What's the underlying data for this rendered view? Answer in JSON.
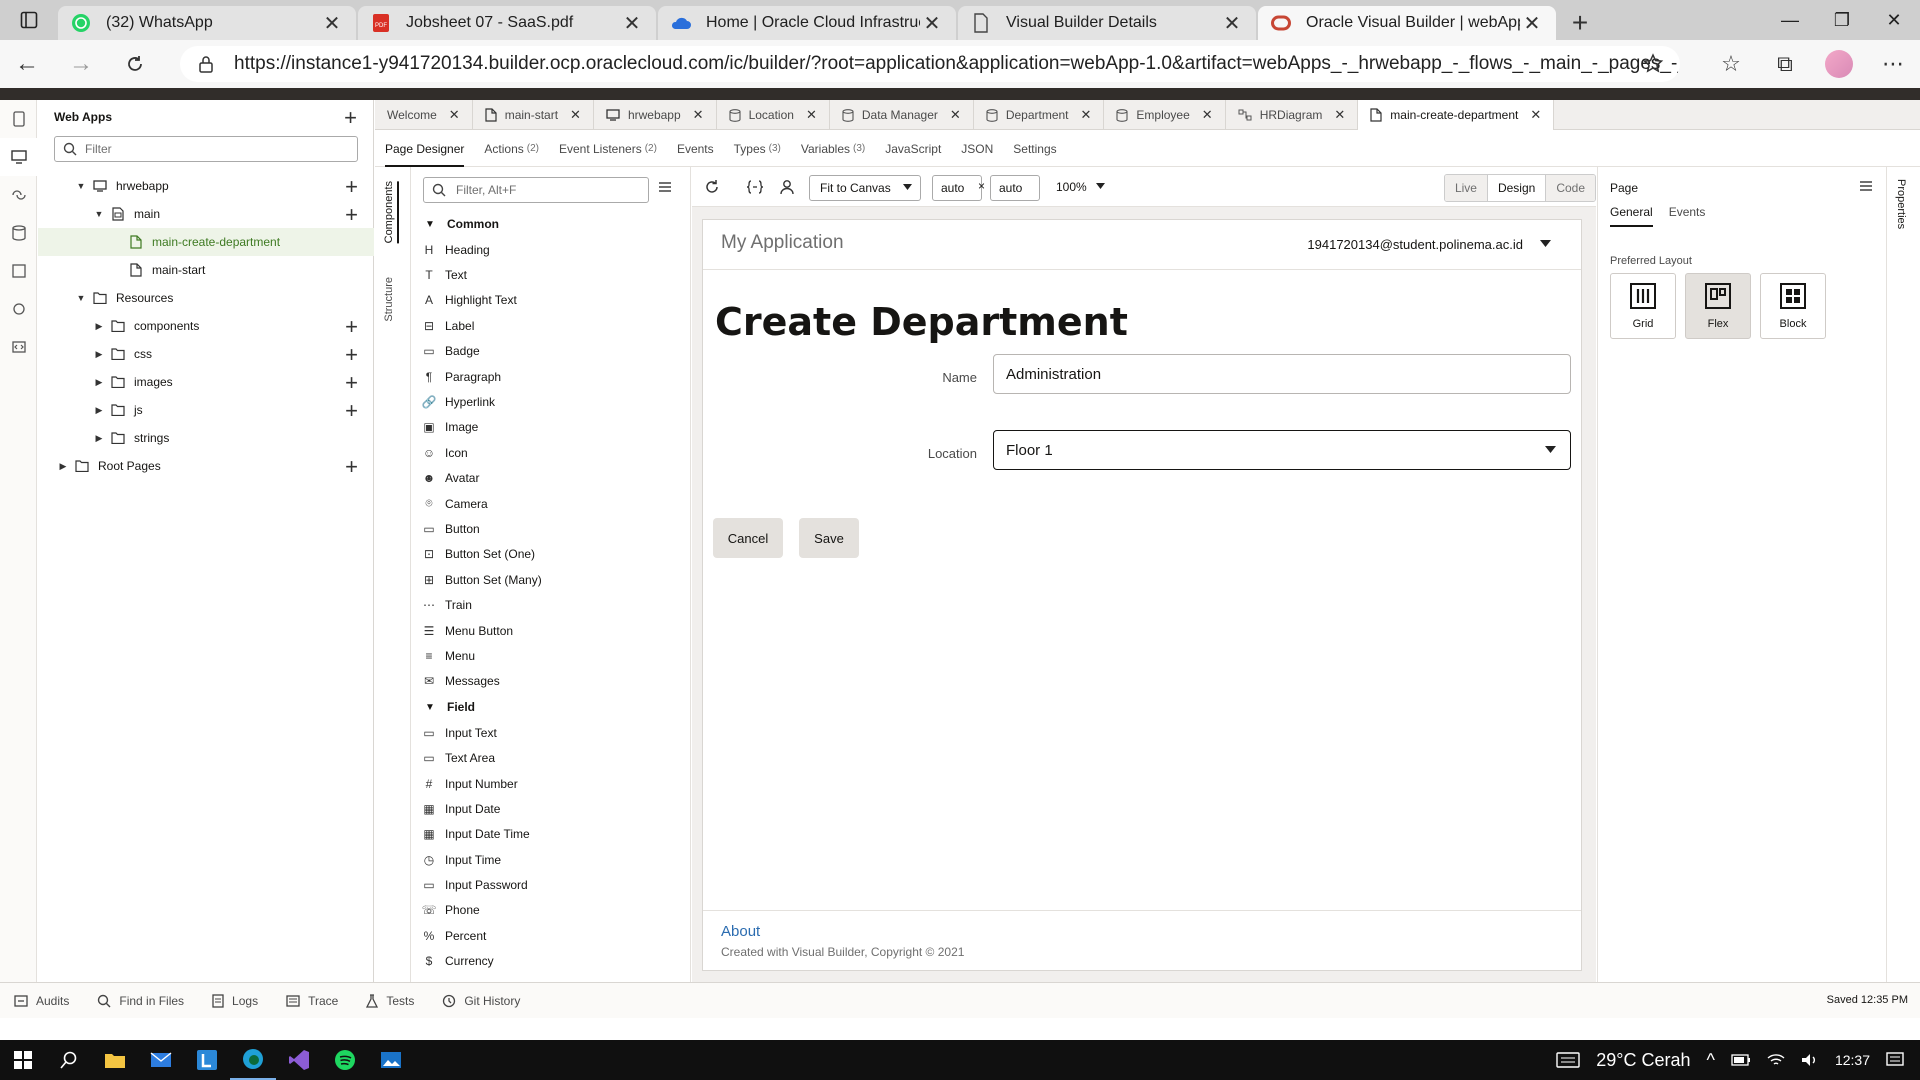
{
  "browser": {
    "tabs": [
      {
        "title": "(32) WhatsApp",
        "icon": "whatsapp-icon"
      },
      {
        "title": "Jobsheet 07 - SaaS.pdf",
        "icon": "pdf-icon"
      },
      {
        "title": "Home | Oracle Cloud Infrastructu",
        "icon": "cloud-icon"
      },
      {
        "title": "Visual Builder Details",
        "icon": "page-icon"
      },
      {
        "title": "Oracle Visual Builder | webApp-1",
        "icon": "oracle-icon"
      }
    ],
    "url": "https://instance1-y941720134.builder.ocp.oraclecloud.com/ic/builder/?root=application&application=webApp-1.0&artifact=webApps_-_hrwebapp_-_flows_-_main_-_pages_-_mai..."
  },
  "navigator": {
    "title": "Web Apps",
    "filter_placeholder": "Filter",
    "tree": [
      {
        "label": "hrwebapp",
        "level": 1,
        "expanded": true,
        "icon": "monitor-icon",
        "add": true
      },
      {
        "label": "main",
        "level": 2,
        "expanded": true,
        "icon": "flow-icon",
        "add": true
      },
      {
        "label": "main-create-department",
        "level": 3,
        "icon": "page-icon",
        "selected": true
      },
      {
        "label": "main-start",
        "level": 3,
        "icon": "page-icon"
      },
      {
        "label": "Resources",
        "level": 1,
        "expanded": true,
        "icon": "folder-icon"
      },
      {
        "label": "components",
        "level": 2,
        "expanded": false,
        "icon": "folder-icon",
        "add": true
      },
      {
        "label": "css",
        "level": 2,
        "expanded": false,
        "icon": "folder-icon",
        "add": true
      },
      {
        "label": "images",
        "level": 2,
        "expanded": false,
        "icon": "folder-icon",
        "add": true
      },
      {
        "label": "js",
        "level": 2,
        "expanded": false,
        "icon": "folder-icon",
        "add": true
      },
      {
        "label": "strings",
        "level": 2,
        "expanded": false,
        "icon": "folder-icon"
      },
      {
        "label": "Root Pages",
        "level": 0,
        "expanded": false,
        "icon": "folder-icon",
        "add": true
      }
    ]
  },
  "editor_tabs": [
    {
      "label": "Welcome",
      "icon": ""
    },
    {
      "label": "main-start",
      "icon": "page-icon"
    },
    {
      "label": "hrwebapp",
      "icon": "monitor-icon"
    },
    {
      "label": "Location",
      "icon": "db-icon"
    },
    {
      "label": "Data Manager",
      "icon": "db-icon"
    },
    {
      "label": "Department",
      "icon": "db-icon"
    },
    {
      "label": "Employee",
      "icon": "db-icon"
    },
    {
      "label": "HRDiagram",
      "icon": "diagram-icon"
    },
    {
      "label": "main-create-department",
      "icon": "page-icon",
      "active": true
    }
  ],
  "designer_tabs": [
    {
      "label": "Page Designer",
      "count": "",
      "active": true
    },
    {
      "label": "Actions",
      "count": "(2)"
    },
    {
      "label": "Event Listeners",
      "count": "(2)"
    },
    {
      "label": "Events",
      "count": ""
    },
    {
      "label": "Types",
      "count": "(3)"
    },
    {
      "label": "Variables",
      "count": "(3)"
    },
    {
      "label": "JavaScript",
      "count": ""
    },
    {
      "label": "JSON",
      "count": ""
    },
    {
      "label": "Settings",
      "count": ""
    }
  ],
  "side_tabs": {
    "components": "Components",
    "structure": "Structure"
  },
  "palette": {
    "filter_placeholder": "Filter, Alt+F",
    "sections": [
      {
        "title": "Common",
        "items": [
          "Heading",
          "Text",
          "Highlight Text",
          "Label",
          "Badge",
          "Paragraph",
          "Hyperlink",
          "Image",
          "Icon",
          "Avatar",
          "Camera",
          "Button",
          "Button Set (One)",
          "Button Set (Many)",
          "Train",
          "Menu Button",
          "Menu",
          "Messages"
        ]
      },
      {
        "title": "Field",
        "items": [
          "Input Text",
          "Text Area",
          "Input Number",
          "Input Date",
          "Input Date Time",
          "Input Time",
          "Input Password",
          "Phone",
          "Percent",
          "Currency"
        ]
      }
    ]
  },
  "canvas_toolbar": {
    "fit": "Fit to Canvas",
    "width": "auto",
    "times": "×",
    "height": "auto",
    "zoom": "100%",
    "modes": [
      "Live",
      "Design",
      "Code"
    ],
    "active_mode": "Design"
  },
  "page": {
    "app_name": "My Application",
    "user": "1941720134@student.polinema.ac.id",
    "title": "Create Department",
    "name_label": "Name",
    "name_value": "Administration",
    "location_label": "Location",
    "location_value": "Floor 1",
    "cancel": "Cancel",
    "save": "Save",
    "footer_link": "About",
    "footer_copy": "Created with Visual Builder, Copyright © 2021"
  },
  "properties": {
    "title": "Page",
    "tabs": [
      "General",
      "Events"
    ],
    "preferred_layout_label": "Preferred Layout",
    "layouts": [
      "Grid",
      "Flex",
      "Block"
    ],
    "selected_layout": "Flex",
    "vertical_tab": "Properties"
  },
  "statusbar": {
    "items": [
      "Audits",
      "Find in Files",
      "Logs",
      "Trace",
      "Tests",
      "Git History"
    ],
    "saved": "Saved 12:35 PM"
  },
  "taskbar": {
    "weather": "29°C Cerah",
    "time": "12:37"
  }
}
